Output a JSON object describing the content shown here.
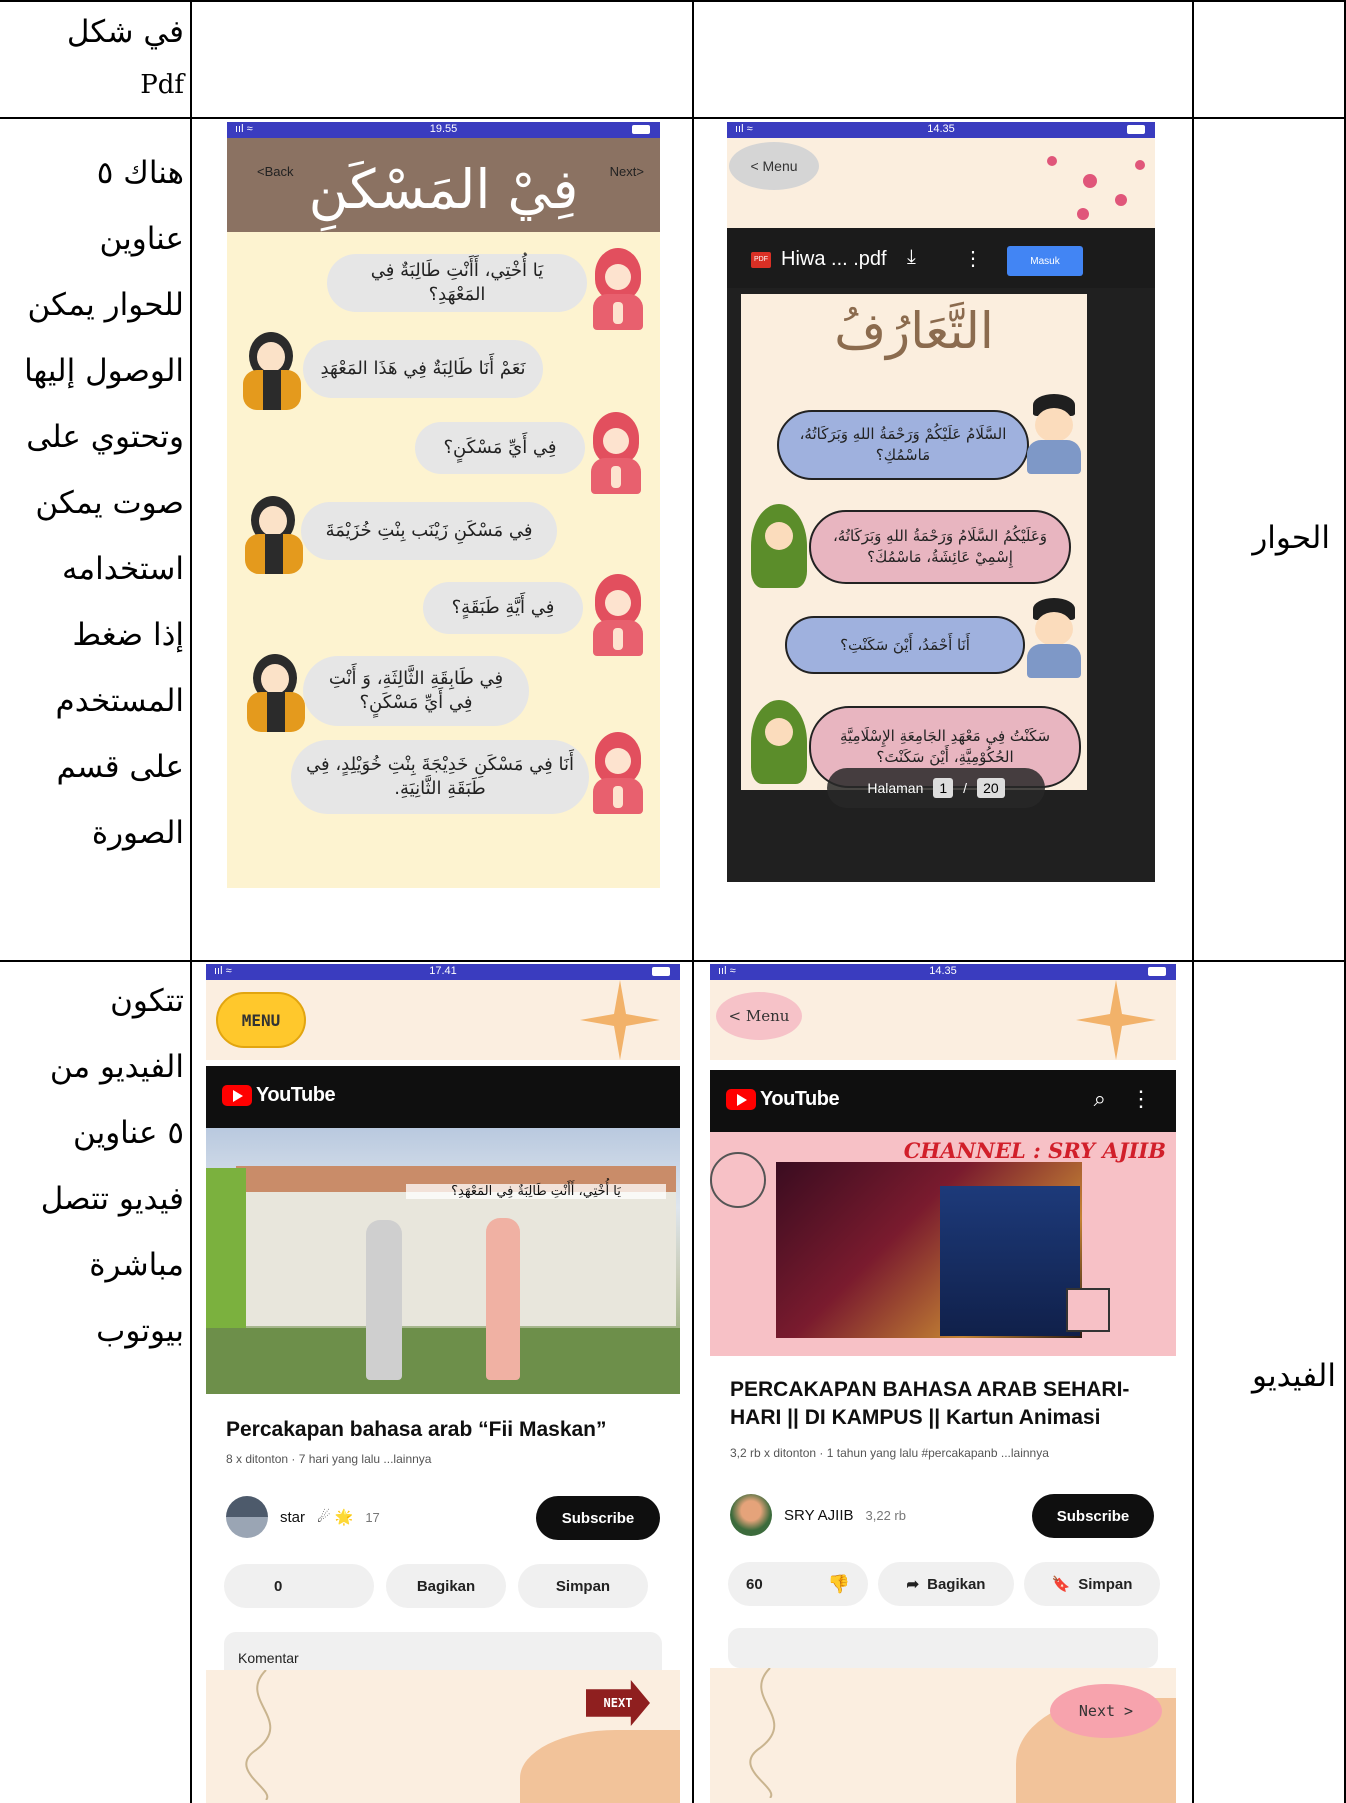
{
  "table": {
    "row0": {
      "desc_lines": [
        "في شكل",
        "Pdf"
      ]
    },
    "row1": {
      "label": "الحوار",
      "desc_lines": [
        "هناك ٥",
        "عناوين",
        "للحوار يمكن",
        "الوصول إليها",
        "وتحتوي على",
        "صوت يمكن",
        "استخدامه",
        "إذا ضغط",
        "المستخدم",
        "على قسم",
        "الصورة"
      ]
    },
    "row2": {
      "label": "الفيديو",
      "desc_lines": [
        "تتكون",
        "الفيديو من",
        "٥ عناوين",
        "فيديو تتصل",
        "مباشرة",
        "بيوتوب"
      ]
    }
  },
  "dialog_screen_1": {
    "status": {
      "time": "19.55",
      "signal": "ııl ≈"
    },
    "back_label": "<Back",
    "next_label": "Next>",
    "title": "فِيْ المَسْكَنِ",
    "bubbles": [
      "يَا أُخْتِي، أَأَنْتِ طَالِبَةٌ فِي المَعْهَدِ؟",
      "نَعَمْ أَنَا طَالِبَةٌ فِي هَذَا المَعْهَدِ",
      "فِي أَيِّ مَسْكَنٍ؟",
      "فِي مَسْكَنِ زَيْنَب بِنْتِ خُزَيْمَةَ",
      "فِي أَيَّةِ طَبَقَةٍ؟",
      "فِي طَابِقَةِ الثَّالِثَةِ، وَ أَنْتِ فِي أَيِّ مَسْكَنٍ؟",
      "أَنَا فِي مَسْكَنِ خَدِيْجَةَ بِنْتِ خُوَيْلِدٍ، فِي طَبَقَةِ الثَّانِيَةِ."
    ]
  },
  "dialog_screen_2": {
    "status": {
      "time": "14.35",
      "signal": "ııl ≈"
    },
    "menu_label": "< Menu",
    "pdf_icon_text": "PDF",
    "file_name": "Hiwa ... .pdf",
    "download_icon": "⤓",
    "more_icon": "⋮",
    "masuk_label": "Masuk",
    "page_title": "التَّعَارُفُ",
    "bubbles": [
      "السَّلَامُ عَلَيْكُمْ وَرَحْمَةُ اللهِ وَبَرَكَاتُهُ، مَاسْمُكِ؟",
      "وَعَلَيْكُمُ السَّلَامُ وَرَحْمَةُ اللهِ وَبَرَكَاتُهُ، إِسْمِيْ عَائِشَةُ، مَاسْمُكَ؟",
      "أَنَا أَحْمَدُ، أَيْنَ سَكَنْتِ؟",
      "سَكَنْتُ فِي مَعْهَدِ الجَامِعَةِ الإِسْلَامِيَّةِ الحُكُوْمِيَّةِ، أَيْنَ سَكَنْتَ؟"
    ],
    "pager": {
      "label": "Halaman",
      "page": "1",
      "sep": "/",
      "total": "20"
    }
  },
  "video_screen_1": {
    "status": {
      "time": "17.41",
      "signal": "ııl ≈"
    },
    "menu_label": "MENU",
    "youtube_label": "YouTube",
    "thumb_caption": "يَا أُخْتِي، أَأَنْتِ طَالِبَةٌ فِي المَعْهَدِ؟",
    "title": "Percakapan bahasa arab “Fii Maskan”",
    "meta": "8 x ditonton · 7 hari yang lalu  ...lainnya",
    "channel": "star",
    "channel_emoji": "☄ 🌟",
    "subs": "17",
    "subscribe": "Subscribe",
    "likes": "0",
    "share": "Bagikan",
    "save": "Simpan",
    "comment": "Komentar",
    "next": "NEXT"
  },
  "video_screen_2": {
    "status": {
      "time": "14.35",
      "signal": "ııl ≈"
    },
    "menu_label": "< Menu",
    "youtube_label": "YouTube",
    "search_icon": "⌕",
    "more_icon": "⋮",
    "thumb_channel": "CHANNEL : SRY AJIIB",
    "title": "PERCAKAPAN BAHASA ARAB SEHARI-HARI || DI KAMPUS || Kartun Animasi",
    "meta": "3,2 rb x ditonton · 1 tahun yang lalu  #percakapanb  ...lainnya",
    "channel": "SRY AJIIB",
    "subs": "3,22 rb",
    "subscribe": "Subscribe",
    "likes": "60",
    "dislike_icon": "👎",
    "share": "Bagikan",
    "save": "Simpan",
    "next": "Next >"
  }
}
